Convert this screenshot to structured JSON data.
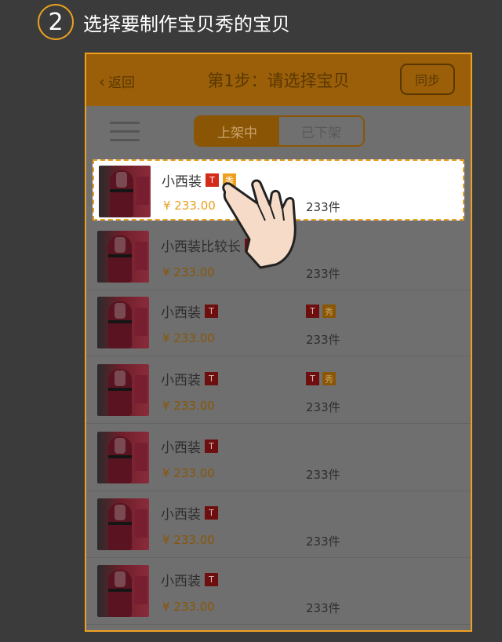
{
  "step": {
    "number": "2",
    "title": "选择要制作宝贝秀的宝贝"
  },
  "topbar": {
    "back_label": "返回",
    "title": "第1步：请选择宝贝",
    "sync_label": "同步"
  },
  "tabs": [
    {
      "label": "上架中",
      "active": true
    },
    {
      "label": "已下架",
      "active": false
    }
  ],
  "tags": {
    "t": "T",
    "show": "秀"
  },
  "items": [
    {
      "name": "小西装",
      "price": "¥ 233.00",
      "count": "233件"
    },
    {
      "name": "小西装比较长",
      "price": "¥ 233.00",
      "count": "233件"
    },
    {
      "name": "小西装",
      "price": "¥ 233.00",
      "count": "233件"
    },
    {
      "name": "小西装",
      "price": "¥ 233.00",
      "count": "233件"
    },
    {
      "name": "小西装",
      "price": "¥ 233.00",
      "count": "233件"
    },
    {
      "name": "小西装",
      "price": "¥ 233.00",
      "count": "233件"
    },
    {
      "name": "小西装",
      "price": "¥ 233.00",
      "count": "233件"
    }
  ],
  "colors": {
    "accent": "#f0a020",
    "tag_t": "#d42a1a",
    "tag_show": "#f0a020",
    "background": "#3b3b3b"
  }
}
